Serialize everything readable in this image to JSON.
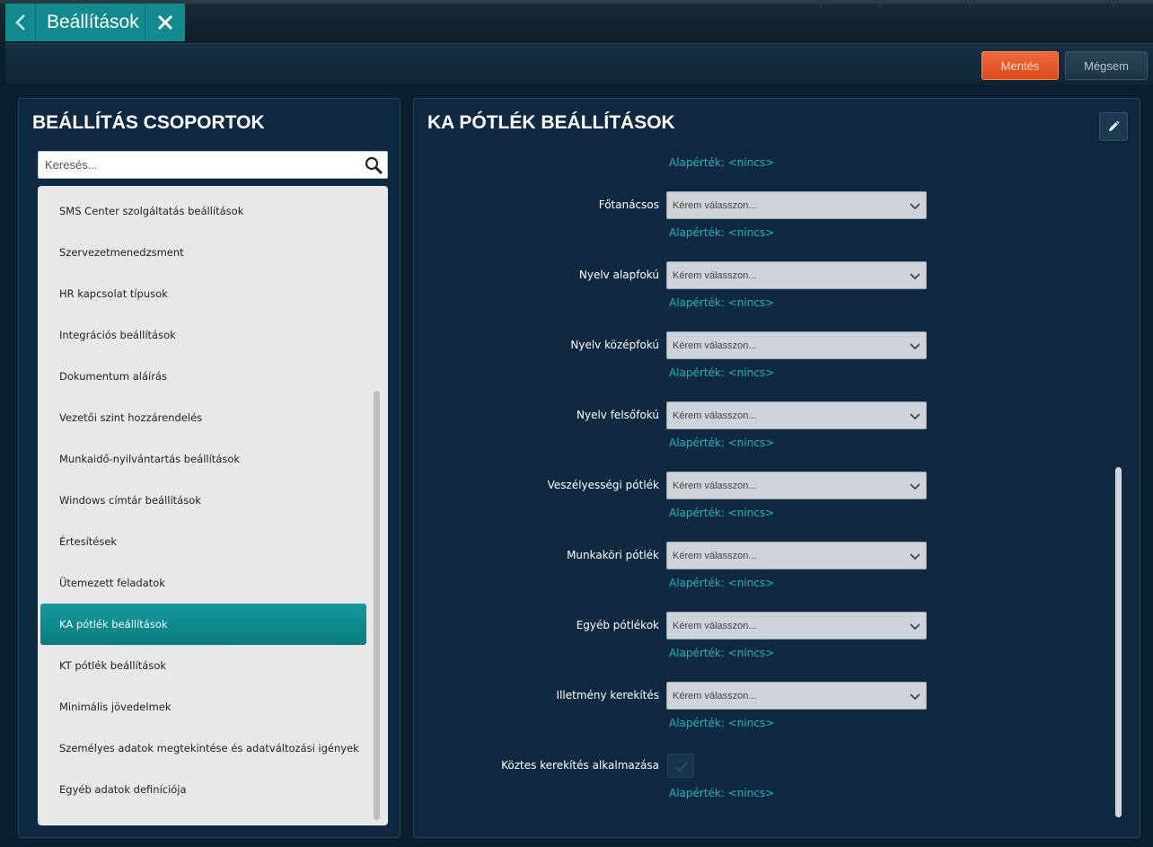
{
  "header": {
    "tab_title": "Beállítások",
    "back_icon": "chevron-left-icon",
    "close_icon": "close-icon"
  },
  "toolbar": {
    "save_label": "Mentés",
    "cancel_label": "Mégsem"
  },
  "left_panel": {
    "title": "BEÁLLÍTÁS CSOPORTOK",
    "search_placeholder": "Keresés...",
    "items": [
      {
        "label": "SMS Center szolgáltatás beállítások",
        "active": false
      },
      {
        "label": "Szervezetmenedzsment",
        "active": false
      },
      {
        "label": "HR kapcsolat típusok",
        "active": false
      },
      {
        "label": "Integrációs beállítások",
        "active": false
      },
      {
        "label": "Dokumentum aláírás",
        "active": false
      },
      {
        "label": "Vezetői szint hozzárendelés",
        "active": false
      },
      {
        "label": "Munkaidő-nyilvántartás beállítások",
        "active": false
      },
      {
        "label": "Windows címtár beállítások",
        "active": false
      },
      {
        "label": "Értesítések",
        "active": false
      },
      {
        "label": "Ütemezett feladatok",
        "active": false
      },
      {
        "label": "KA pótlék beállítások",
        "active": true
      },
      {
        "label": "KT pótlék beállítások",
        "active": false
      },
      {
        "label": "Minimális jövedelmek",
        "active": false
      },
      {
        "label": "Személyes adatok megtekintése és adatváltozási igények",
        "active": false
      },
      {
        "label": "Egyéb adatok definíciója",
        "active": false
      }
    ]
  },
  "right_panel": {
    "title": "KA PÓTLÉK BEÁLLÍTÁSOK",
    "top_default": "Alapérték: <nincs>",
    "fields": [
      {
        "label": "Főtanácsos",
        "placeholder": "Kérem válasszon...",
        "default": "Alapérték: <nincs>"
      },
      {
        "label": "Nyelv alapfokú",
        "placeholder": "Kérem válasszon...",
        "default": "Alapérték: <nincs>"
      },
      {
        "label": "Nyelv középfokú",
        "placeholder": "Kérem válasszon...",
        "default": "Alapérték: <nincs>"
      },
      {
        "label": "Nyelv felsőfokú",
        "placeholder": "Kérem válasszon...",
        "default": "Alapérték: <nincs>"
      },
      {
        "label": "Veszélyességi pótlék",
        "placeholder": "Kérem válasszon...",
        "default": "Alapérték: <nincs>"
      },
      {
        "label": "Munkaköri pótlék",
        "placeholder": "Kérem válasszon...",
        "default": "Alapérték: <nincs>"
      },
      {
        "label": "Egyéb pótlékok",
        "placeholder": "Kérem válasszon...",
        "default": "Alapérték: <nincs>"
      },
      {
        "label": "Illetmény kerekítés",
        "placeholder": "Kérem válasszon...",
        "default": "Alapérték: <nincs>"
      }
    ],
    "checkbox_field": {
      "label": "Köztes kerekítés alkalmazása",
      "default": "Alapérték: <nincs>",
      "checked": false
    }
  }
}
